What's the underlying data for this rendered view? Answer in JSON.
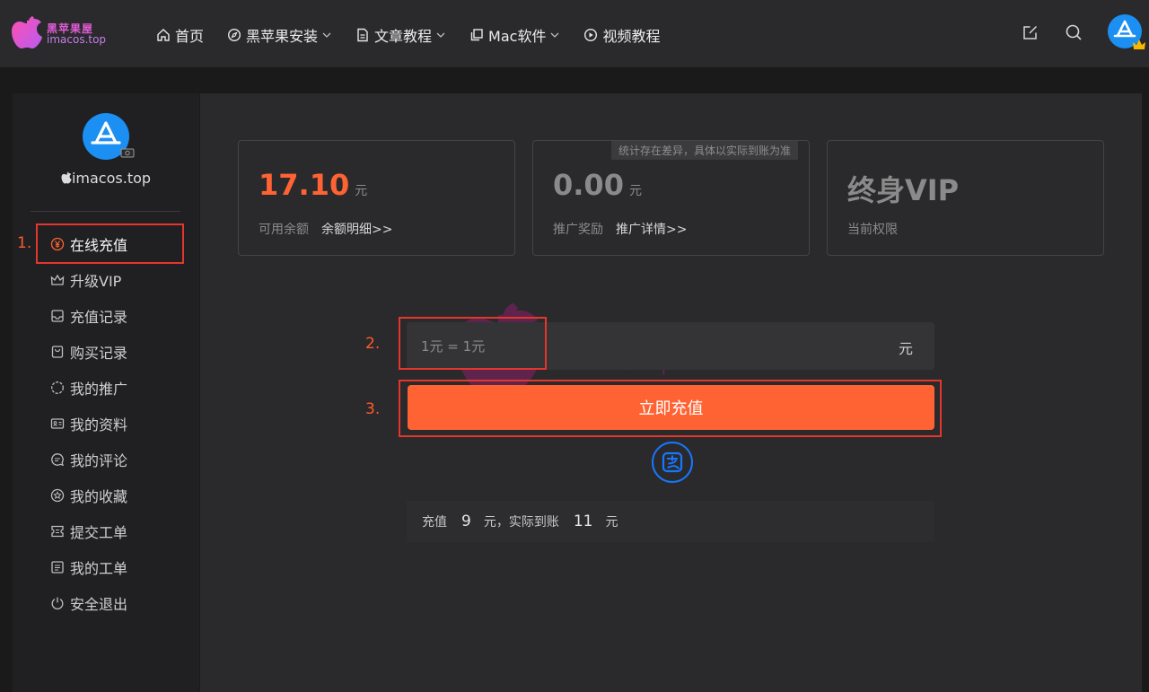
{
  "brand": {
    "name_cn": "黑苹果屋",
    "name_en": "imacos.top",
    "logo_color": "#e05bd6"
  },
  "nav": {
    "items": [
      {
        "label": "首页",
        "icon": "home-icon",
        "has_dropdown": false
      },
      {
        "label": "黑苹果安装",
        "icon": "compass-icon",
        "has_dropdown": true
      },
      {
        "label": "文章教程",
        "icon": "document-icon",
        "has_dropdown": true
      },
      {
        "label": "Mac软件",
        "icon": "copy-icon",
        "has_dropdown": true
      },
      {
        "label": "视频教程",
        "icon": "play-circle-icon",
        "has_dropdown": false
      }
    ],
    "right_icons": [
      "edit-icon",
      "search-icon",
      "user-avatar"
    ]
  },
  "sidebar": {
    "username": "imacos.top",
    "username_prefix_icon": "apple-icon",
    "items": [
      {
        "label": "在线充值",
        "icon": "yen-icon",
        "active": true
      },
      {
        "label": "升级VIP",
        "icon": "crown-icon",
        "active": false
      },
      {
        "label": "充值记录",
        "icon": "inbox-icon",
        "active": false
      },
      {
        "label": "购买记录",
        "icon": "shopping-bag-icon",
        "active": false
      },
      {
        "label": "我的推广",
        "icon": "share-circle-icon",
        "active": false
      },
      {
        "label": "我的资料",
        "icon": "id-card-icon",
        "active": false
      },
      {
        "label": "我的评论",
        "icon": "comment-icon",
        "active": false
      },
      {
        "label": "我的收藏",
        "icon": "star-circle-icon",
        "active": false
      },
      {
        "label": "提交工单",
        "icon": "ticket-icon",
        "active": false
      },
      {
        "label": "我的工单",
        "icon": "ticket-list-icon",
        "active": false
      },
      {
        "label": "安全退出",
        "icon": "power-icon",
        "active": false
      }
    ]
  },
  "stats": {
    "balance": {
      "value": "17.10",
      "unit": "元",
      "label": "可用余额",
      "link": "余额明细>>",
      "color": "#ff6333"
    },
    "referral": {
      "value": "0.00",
      "unit": "元",
      "label": "推广奖励",
      "link": "推广详情>>",
      "tip": "统计存在差异，具体以实际到账为准",
      "color": "#8a8a8a"
    },
    "vip": {
      "value": "终身VIP",
      "label": "当前权限",
      "color": "#8a8a8a"
    }
  },
  "recharge": {
    "amount_placeholder": "1元 = 1元",
    "amount_unit": "元",
    "submit_label": "立即充值",
    "payment_method_icon": "alipay-icon",
    "bonus": {
      "prefix": "充值",
      "pay_amount": "9",
      "middle": "元，实际到账",
      "receive_amount": "11",
      "suffix": "元"
    }
  },
  "annotations": {
    "step1": "1.",
    "step2": "2.",
    "step3": "3.",
    "color": "#e4362d"
  },
  "watermark": {
    "cn": "黑苹果屋",
    "en": "imacos.top"
  }
}
